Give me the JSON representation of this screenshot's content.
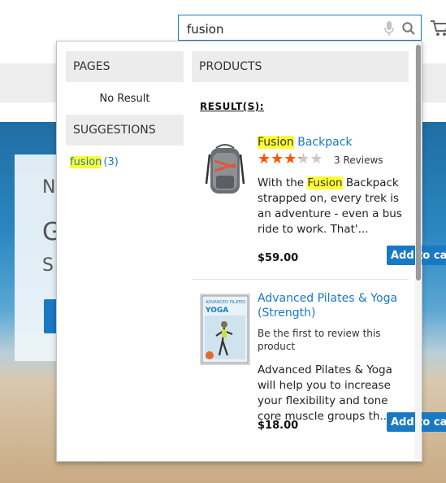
{
  "search": {
    "query": "fusion"
  },
  "hero": {
    "letters": [
      "N",
      "G",
      "S"
    ]
  },
  "autocomplete": {
    "pages": {
      "heading": "PAGES",
      "empty_text": "No Result"
    },
    "suggestions": {
      "heading": "SUGGESTIONS",
      "items": [
        {
          "term": "fusion",
          "count": "(3)"
        }
      ]
    },
    "products": {
      "heading": "PRODUCTS",
      "results_label": "RESULT(S):",
      "items": [
        {
          "name_highlight": "Fusion",
          "name_rest": " Backpack",
          "rating_fraction": 0.6,
          "reviews": "3 Reviews",
          "desc_before": "With the ",
          "desc_highlight": "Fusion",
          "desc_after": " Backpack strapped on, every trek is an adventure - even a bus ride to work. That'...",
          "price": "$59.00",
          "add_to_cart": "Add to cart",
          "image": "backpack"
        },
        {
          "name": "Advanced Pilates & Yoga (Strength)",
          "review_prompt": "Be the first to review this product",
          "desc": "Advanced Pilates & Yoga will help you to increase your flexibility and tone core muscle groups th...",
          "price": "$18.00",
          "add_to_cart": "Add to cart",
          "image": "dvd-cover",
          "cover_lines": [
            "ADVANCED PILATES",
            "YOGA"
          ]
        }
      ]
    }
  },
  "icons": [
    "microphone-icon",
    "search-icon",
    "cart-icon",
    "star-icon"
  ],
  "colors": {
    "accent": "#1979c3",
    "highlight": "#ffff33",
    "star": "#ff5501"
  }
}
